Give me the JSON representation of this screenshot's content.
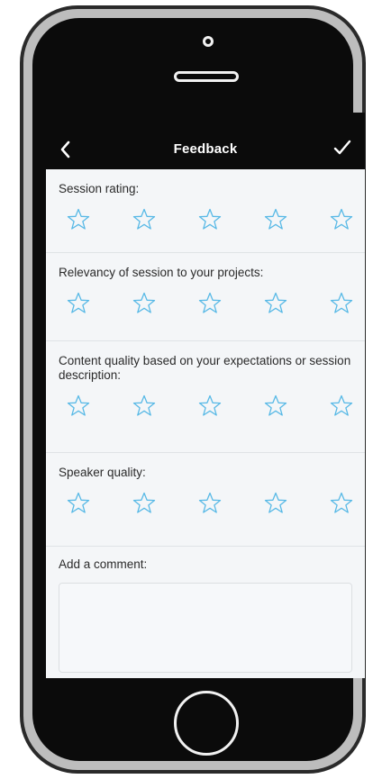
{
  "header": {
    "back_icon": "chevron-left-icon",
    "title": "Feedback",
    "done_icon": "checkmark-icon"
  },
  "questions": [
    {
      "label": "Session rating:",
      "stars_total": 5,
      "stars_selected": 0
    },
    {
      "label": "Relevancy of session to your projects:",
      "stars_total": 5,
      "stars_selected": 0
    },
    {
      "label": "Content quality based on your expectations or session description:",
      "stars_total": 5,
      "stars_selected": 0
    },
    {
      "label": "Speaker quality:",
      "stars_total": 5,
      "stars_selected": 0
    }
  ],
  "comment": {
    "label": "Add a comment:",
    "value": "",
    "placeholder": ""
  },
  "colors": {
    "nav_background": "#0b0b0b",
    "screen_background": "#f4f6f8",
    "star_outline": "#58b9e6",
    "text": "#2a2a2a",
    "divider": "#dfe3e6"
  }
}
